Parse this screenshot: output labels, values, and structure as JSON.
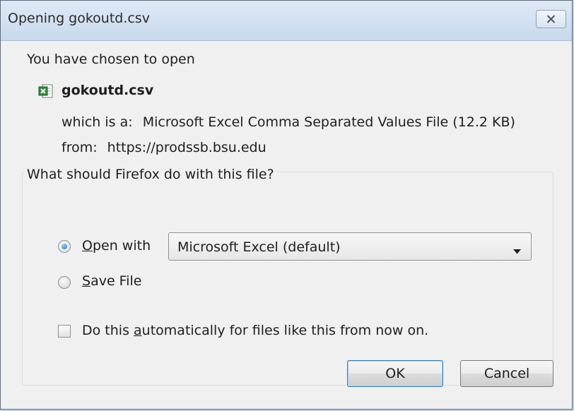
{
  "window": {
    "title": "Opening gokoutd.csv"
  },
  "intro_text": "You have chosen to open",
  "file": {
    "icon": "excel-file-icon",
    "name": "gokoutd.csv",
    "which_label": "which is a:",
    "which_value": "Microsoft Excel Comma Separated Values File (12.2 KB)",
    "from_label": "from:",
    "from_value": "https://prodssb.bsu.edu"
  },
  "action_group": {
    "legend": "What should Firefox do with this file?",
    "open_with": {
      "label_prefix": "",
      "label_accel": "O",
      "label_rest": "pen with",
      "selected": true,
      "app_value": "Microsoft Excel (default)"
    },
    "save_file": {
      "label_accel": "S",
      "label_rest": "ave File",
      "selected": false
    },
    "auto_checkbox": {
      "label_prefix": "Do this ",
      "label_accel": "a",
      "label_rest": "utomatically for files like this from now on.",
      "checked": false
    }
  },
  "buttons": {
    "ok": "OK",
    "cancel": "Cancel"
  },
  "colors": {
    "titlebar": "#c7d9ee",
    "radio_selected": "#1c6fc8",
    "ok_focus_border": "#3c7fb1"
  }
}
